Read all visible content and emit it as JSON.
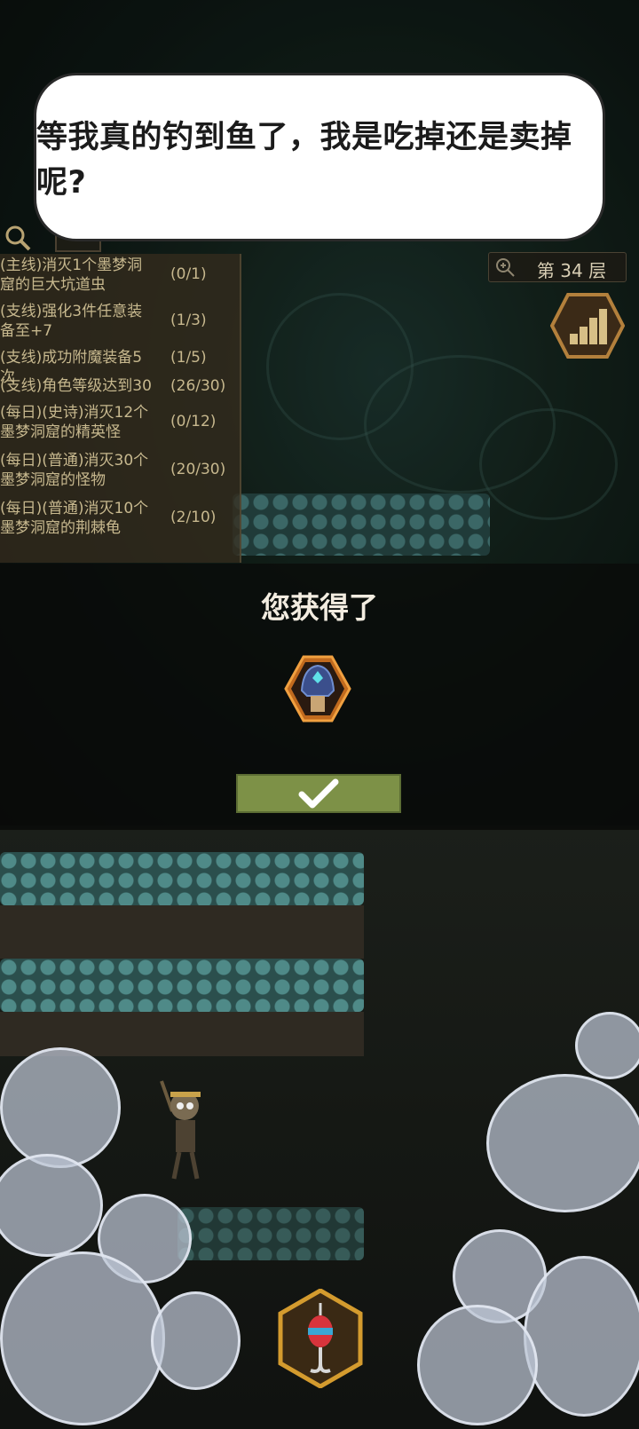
{
  "speech": {
    "text": "等我真的钓到鱼了，我是吃掉还是卖掉呢?"
  },
  "quests": [
    {
      "name": "(主线)消灭1个墨梦洞窟的巨大坑道虫",
      "progress": "(0/1)"
    },
    {
      "name": "(支线)强化3件任意装备至+7",
      "progress": "(1/3)"
    },
    {
      "name": "(支线)成功附魔装备5次",
      "progress": "(1/5)"
    },
    {
      "name": "(支线)角色等级达到30",
      "progress": "(26/30)"
    },
    {
      "name": "(每日)(史诗)消灭12个墨梦洞窟的精英怪",
      "progress": "(0/12)"
    },
    {
      "name": "(每日)(普通)消灭30个墨梦洞窟的怪物",
      "progress": "(20/30)"
    },
    {
      "name": "(每日)(普通)消灭10个墨梦洞窟的荆棘龟",
      "progress": "(2/10)"
    }
  ],
  "floor": {
    "label": "第 34 层"
  },
  "reward": {
    "title": "您获得了",
    "item_icon": "armor-helmet-icon",
    "confirm_icon": "checkmark-icon"
  },
  "colors": {
    "confirm_button": "#7d9147",
    "quest_text": "#c7b88e",
    "bubble_bg": "#ffffff"
  },
  "bottom": {
    "action_icon": "fishing-hook-icon"
  }
}
